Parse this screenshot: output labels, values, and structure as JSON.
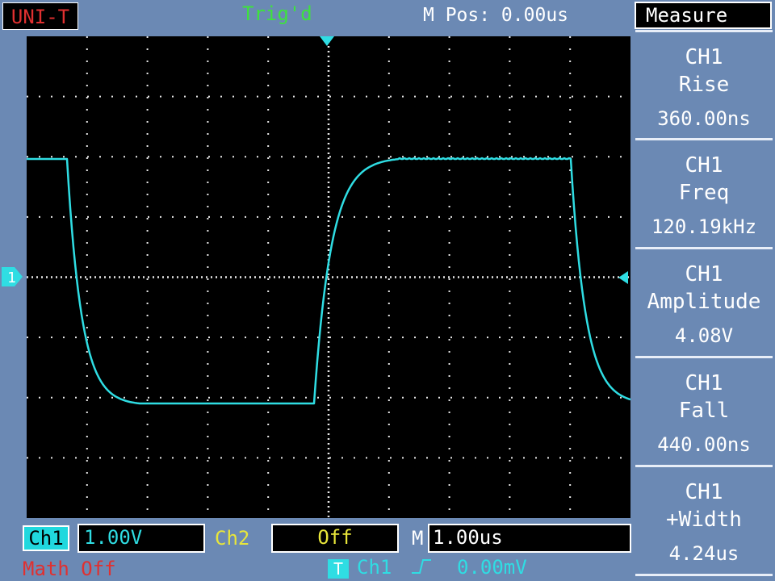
{
  "header": {
    "brand": "UNI-T",
    "trigger_status": "Trig'd",
    "m_pos": "M Pos: 0.00us"
  },
  "screen": {
    "ch1_marker": "1",
    "trace_color": "#2fdde3"
  },
  "measure": {
    "title": "Measure",
    "items": [
      {
        "source": "CH1",
        "type": "Rise",
        "value": "360.00ns"
      },
      {
        "source": "CH1",
        "type": "Freq",
        "value": "120.19kHz"
      },
      {
        "source": "CH1",
        "type": "Amplitude",
        "value": "4.08V"
      },
      {
        "source": "CH1",
        "type": "Fall",
        "value": "440.00ns"
      },
      {
        "source": "CH1",
        "type": "+Width",
        "value": "4.24us"
      }
    ]
  },
  "bottom": {
    "ch1_label": "Ch1",
    "ch1_scale": "1.00V",
    "ch2_label": "Ch2",
    "ch2_state": "Off",
    "m_label": "M",
    "timebase": "1.00us",
    "math": "Math Off",
    "trig_badge": "T",
    "trig_source": "Ch1",
    "trig_level": "0.00mV"
  },
  "colors": {
    "background": "#6b89b4",
    "trace": "#2fdde3",
    "brand": "#e03030",
    "trig": "#3ee23e",
    "ch2": "#e8e63a"
  }
}
